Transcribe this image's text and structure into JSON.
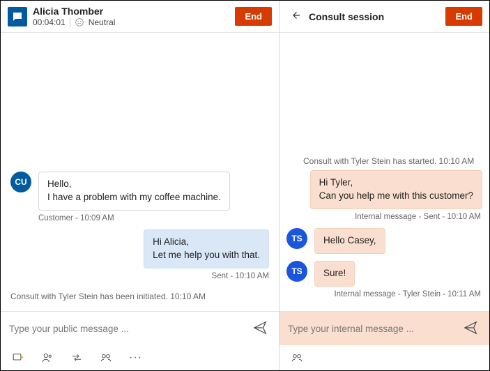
{
  "left": {
    "customer_name": "Alicia Thomber",
    "timer": "00:04:01",
    "sentiment": "Neutral",
    "end_label": "End",
    "messages": {
      "cu_avatar": "CU",
      "cu_text": "Hello,\nI have a problem with my coffee machine.",
      "cu_meta": "Customer - 10:09 AM",
      "agent_text": "Hi Alicia,\nLet me help you with that.",
      "agent_meta": "Sent - 10:10 AM",
      "consult_initiated": "Consult with Tyler Stein has been initiated. 10:10 AM"
    },
    "composer_placeholder": "Type your public message ..."
  },
  "right": {
    "title": "Consult session",
    "end_label": "End",
    "consult_started": "Consult with Tyler Stein has started. 10:10 AM",
    "out_text": "Hi Tyler,\nCan you help me with this customer?",
    "out_meta": "Internal message - Sent - 10:10 AM",
    "ts_avatar": "TS",
    "in1_text": "Hello Casey,",
    "in2_text": "Sure!",
    "in_meta": "Internal message - Tyler Stein - 10:11 AM",
    "composer_placeholder": "Type your internal message ..."
  }
}
